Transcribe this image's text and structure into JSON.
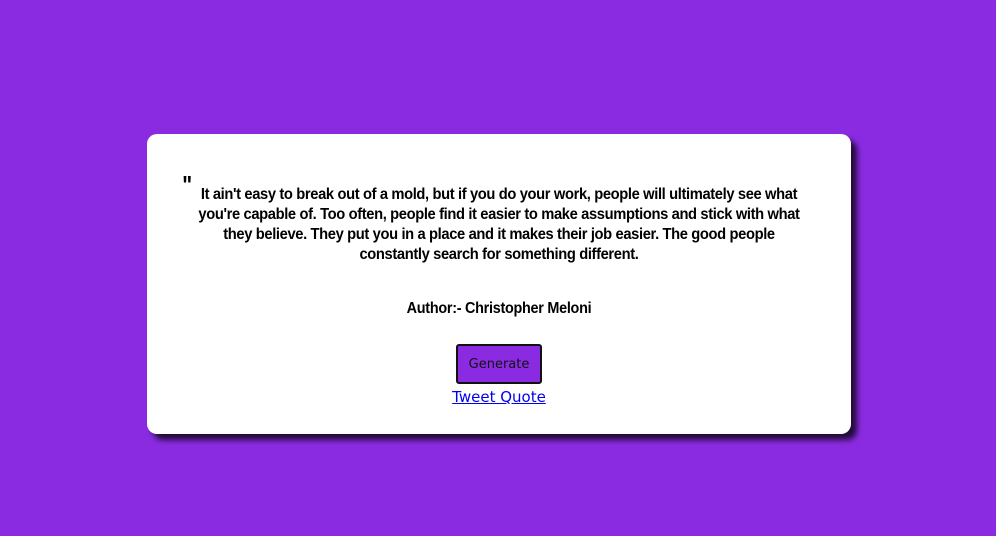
{
  "colors": {
    "background": "#8a2be2",
    "card": "#ffffff",
    "button": "#8a2be2",
    "link": "#0000ee"
  },
  "quote": {
    "mark": "\"",
    "text": "It ain't easy to break out of a mold, but if you do your work, people will ultimately see what you're capable of. Too often, people find it easier to make assumptions and stick with what they believe. They put you in a place and it makes their job easier. The good people constantly search for something different."
  },
  "author": {
    "label": "Author:- Christopher Meloni"
  },
  "actions": {
    "generate_label": "Generate",
    "tweet_label": "Tweet Quote"
  }
}
